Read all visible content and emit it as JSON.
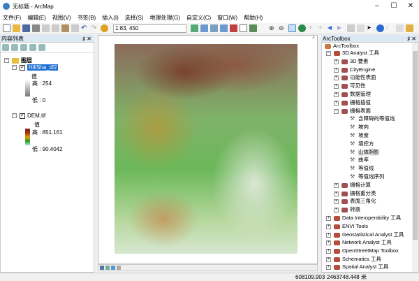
{
  "window": {
    "title": "无标题 - ArcMap",
    "min": "–",
    "max": "☐",
    "close": "✕"
  },
  "menu": [
    "文件(F)",
    "编辑(E)",
    "视图(V)",
    "书签(B)",
    "插入(I)",
    "选择(S)",
    "地理处理(G)",
    "自定义(C)",
    "窗口(W)",
    "帮助(H)"
  ],
  "toolbar": {
    "scale": "1:83, 450"
  },
  "toc": {
    "title": "内容列表",
    "pin": "♯ ✕",
    "group": "图层",
    "layers": [
      {
        "name": "HillSha_tif2",
        "value": "值",
        "high": "高 : 254",
        "low": "低 : 0"
      },
      {
        "name": "DEM.tif",
        "value": "值",
        "high": "高 : 851.161",
        "low": "低 : 90.4042"
      }
    ]
  },
  "toolbox": {
    "title": "ArcToolbox",
    "pin": "♯ ✕",
    "root": "ArcToolbox",
    "items": [
      "3D Analyst 工具",
      "3D 要素",
      "CityEngine",
      "功能性表面",
      "可见性",
      "数据管理",
      "栅格插值",
      "栅格表面",
      "含障碍的等值线",
      "坡向",
      "坡度",
      "填挖方",
      "山体阴影",
      "曲率",
      "等值线",
      "等值线序列",
      "栅格计算",
      "栅格重分类",
      "表面三角化",
      "转换",
      "Data Interoperability 工具",
      "ENVI Tools",
      "Geostatistical Analyst 工具",
      "Network Analyst 工具",
      "OpenStreetMap Toolbox",
      "Schematics 工具",
      "Spatial Analyst 工具"
    ]
  },
  "status": {
    "x": "608109.903",
    "y": "2463748.448 米"
  }
}
